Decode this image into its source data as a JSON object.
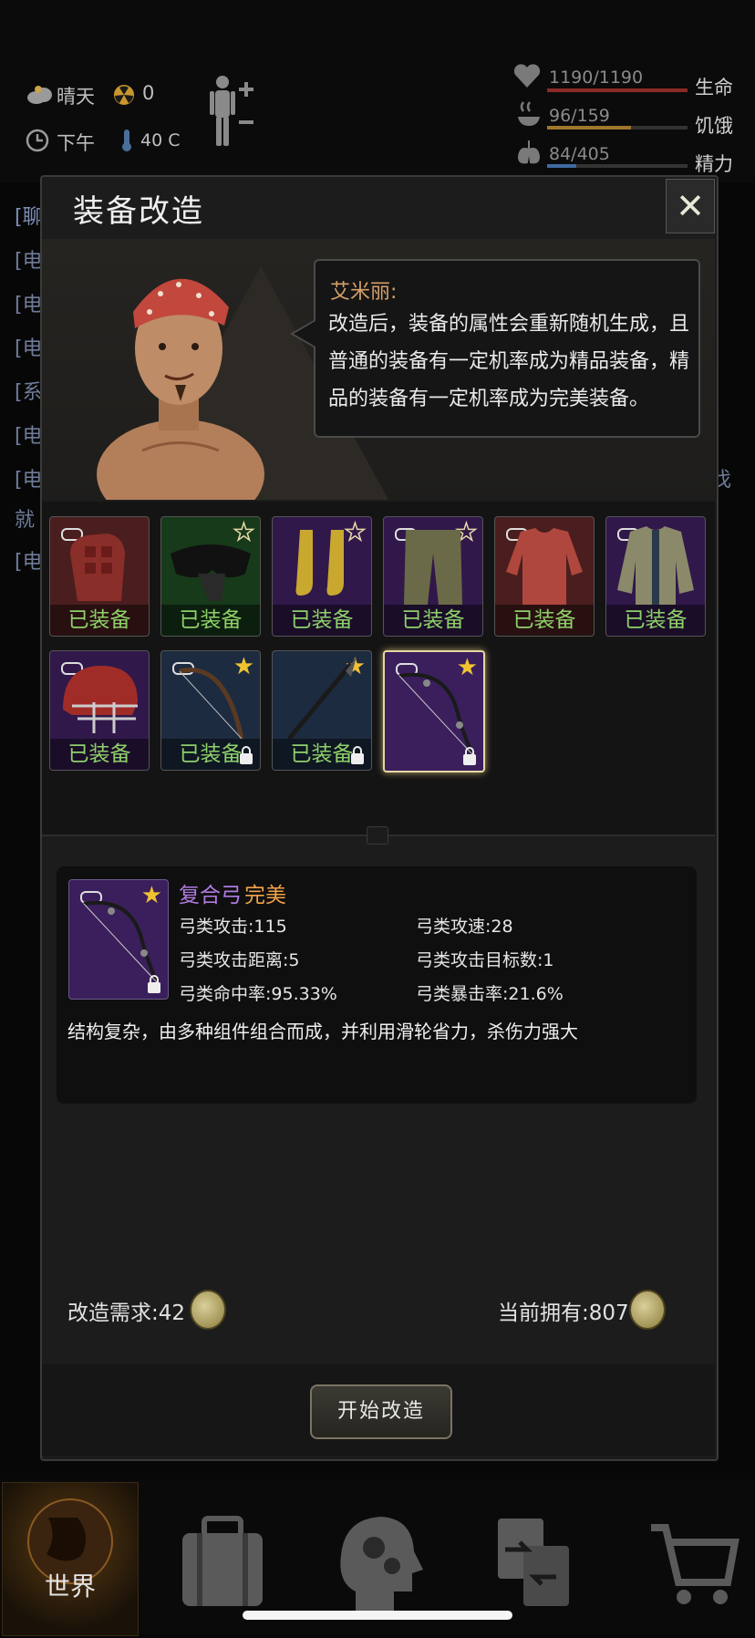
{
  "status": {
    "weather": "晴天",
    "radiation": "0",
    "time_of_day": "下午",
    "temperature": "40 C",
    "health": {
      "value": "1190/1190",
      "label": "生命",
      "fill": 1.0
    },
    "hunger": {
      "value": "96/159",
      "label": "饥饿",
      "fill": 0.6
    },
    "energy": {
      "value": "84/405",
      "label": "精力",
      "fill": 0.21
    }
  },
  "log": {
    "lines": [
      "[聊",
      "[电",
      "[电",
      "[电",
      "[系",
      "[电",
      "[电",
      "就",
      "[电"
    ],
    "side_char": "伐"
  },
  "modal": {
    "title": "装备改造",
    "close_label": "✕",
    "speaker": "艾米丽:",
    "speech": "改造后，装备的属性会重新随机生成，且普通的装备有一定机率成为精品装备，精品的装备有一定机率成为完美装备。",
    "slots": [
      {
        "item": "gloves",
        "caption": "已装备",
        "bg": "#4a1e1e",
        "star": false,
        "chain": true,
        "lock": false
      },
      {
        "item": "goggles",
        "caption": "已装备",
        "bg": "#173a1a",
        "star": true,
        "star_style": "outline",
        "chain": false,
        "lock": false
      },
      {
        "item": "socks",
        "caption": "已装备",
        "bg": "#31184a",
        "star": true,
        "star_style": "outline",
        "chain": false,
        "lock": false
      },
      {
        "item": "pants",
        "caption": "已装备",
        "bg": "#31184a",
        "star": true,
        "star_style": "outline",
        "chain": true,
        "lock": false
      },
      {
        "item": "shirt",
        "caption": "已装备",
        "bg": "#4a1e1e",
        "star": false,
        "chain": true,
        "lock": false
      },
      {
        "item": "jacket",
        "caption": "已装备",
        "bg": "#31184a",
        "star": false,
        "chain": true,
        "lock": false
      },
      {
        "item": "helmet",
        "caption": "已装备",
        "bg": "#31184a",
        "star": false,
        "chain": true,
        "lock": false
      },
      {
        "item": "bow",
        "caption": "已装备",
        "bg": "#1d2b40",
        "star": true,
        "star_style": "filled",
        "chain": true,
        "lock": true
      },
      {
        "item": "spear",
        "caption": "已装备",
        "bg": "#1d2b40",
        "star": true,
        "star_style": "filled",
        "chain": false,
        "lock": true
      },
      {
        "item": "compound-bow",
        "caption": "",
        "bg": "#3a1f5c",
        "star": true,
        "star_style": "filled",
        "chain": true,
        "lock": true,
        "selected": true
      }
    ],
    "detail": {
      "name": "复合弓",
      "quality": "完美",
      "attrs": [
        [
          "弓类攻击:115",
          "弓类攻速:28"
        ],
        [
          "弓类攻击距离:5",
          "弓类攻击目标数:1"
        ],
        [
          "弓类命中率:95.33%",
          "弓类暴击率:21.6%"
        ]
      ],
      "description": "结构复杂，由多种组件组合而成，并利用滑轮省力，杀伤力强大"
    },
    "requirement": "改造需求:42",
    "owned": "当前拥有:807",
    "start_button": "开始改造"
  },
  "nav": {
    "tabs": [
      {
        "label": "世界",
        "icon": "globe-icon",
        "active": true
      },
      {
        "label": "",
        "icon": "suitcase-icon",
        "active": false
      },
      {
        "label": "",
        "icon": "head-gears-icon",
        "active": false
      },
      {
        "label": "",
        "icon": "swap-icon",
        "active": false
      },
      {
        "label": "",
        "icon": "cart-icon",
        "active": false
      }
    ]
  }
}
